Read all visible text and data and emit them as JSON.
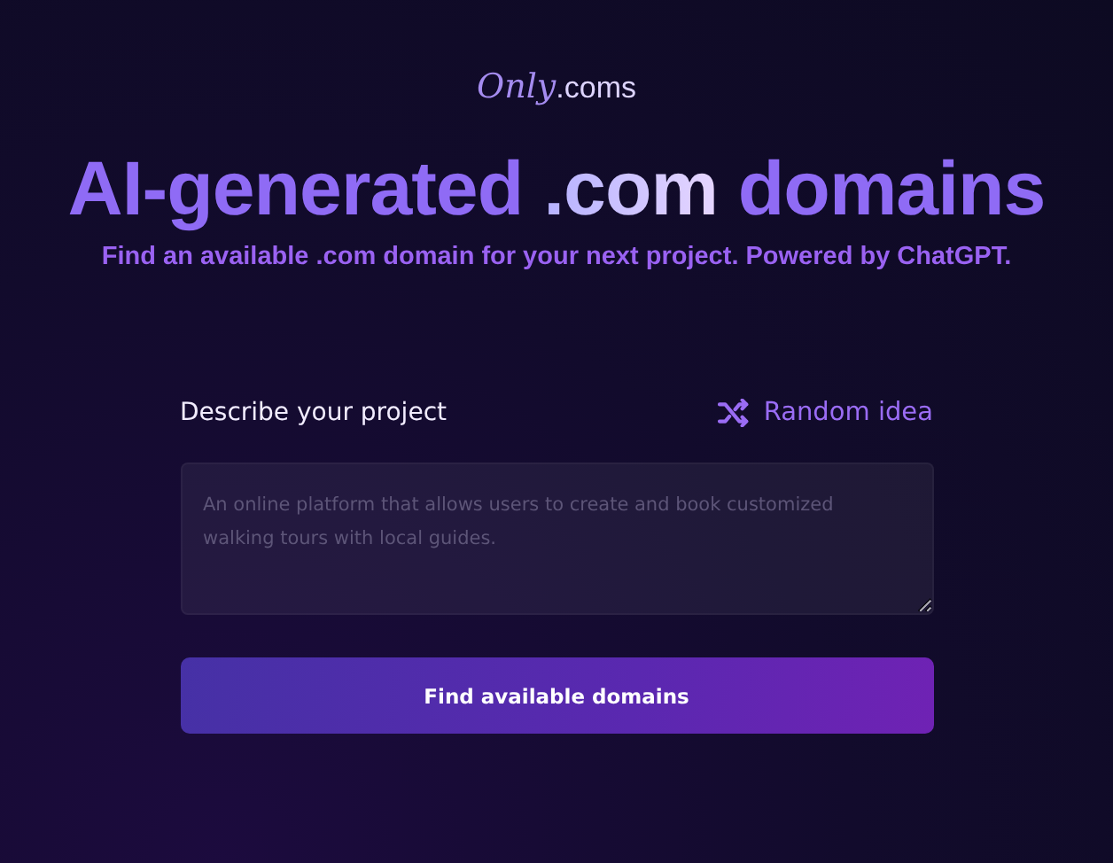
{
  "logo": {
    "script": "Only",
    "suffix": ".coms"
  },
  "headline": {
    "parts": [
      {
        "text": "AI-generated",
        "kind": "plain"
      },
      {
        "text": ".com",
        "kind": "highlight"
      },
      {
        "text": "domains",
        "kind": "plain"
      }
    ]
  },
  "subtitle": "Find an available .com domain for your next project. Powered by ChatGPT.",
  "form": {
    "label": "Describe your project",
    "random_button": "Random idea",
    "placeholder": "An online platform that allows users to create and book customized walking tours with local guides.",
    "submit": "Find available domains"
  }
}
